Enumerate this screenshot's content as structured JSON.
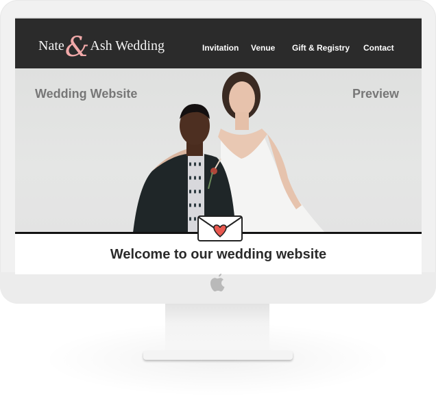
{
  "site": {
    "logo": {
      "first": "Nate",
      "amp": "&",
      "second": "Ash Wedding"
    },
    "nav": [
      {
        "label": "Invitation"
      },
      {
        "label": "Venue"
      },
      {
        "label": "Gift & Registry"
      },
      {
        "label": "Contact"
      }
    ]
  },
  "hero": {
    "left_label": "Wedding Website",
    "right_label": "Preview"
  },
  "welcome": "Welcome to our wedding website",
  "colors": {
    "header_bg": "#2b2b2b",
    "logo_accent": "#f1a9a9",
    "heart": "#e8584f"
  },
  "icons": {
    "envelope": "envelope-heart-icon",
    "device_logo": "apple-logo-icon"
  }
}
